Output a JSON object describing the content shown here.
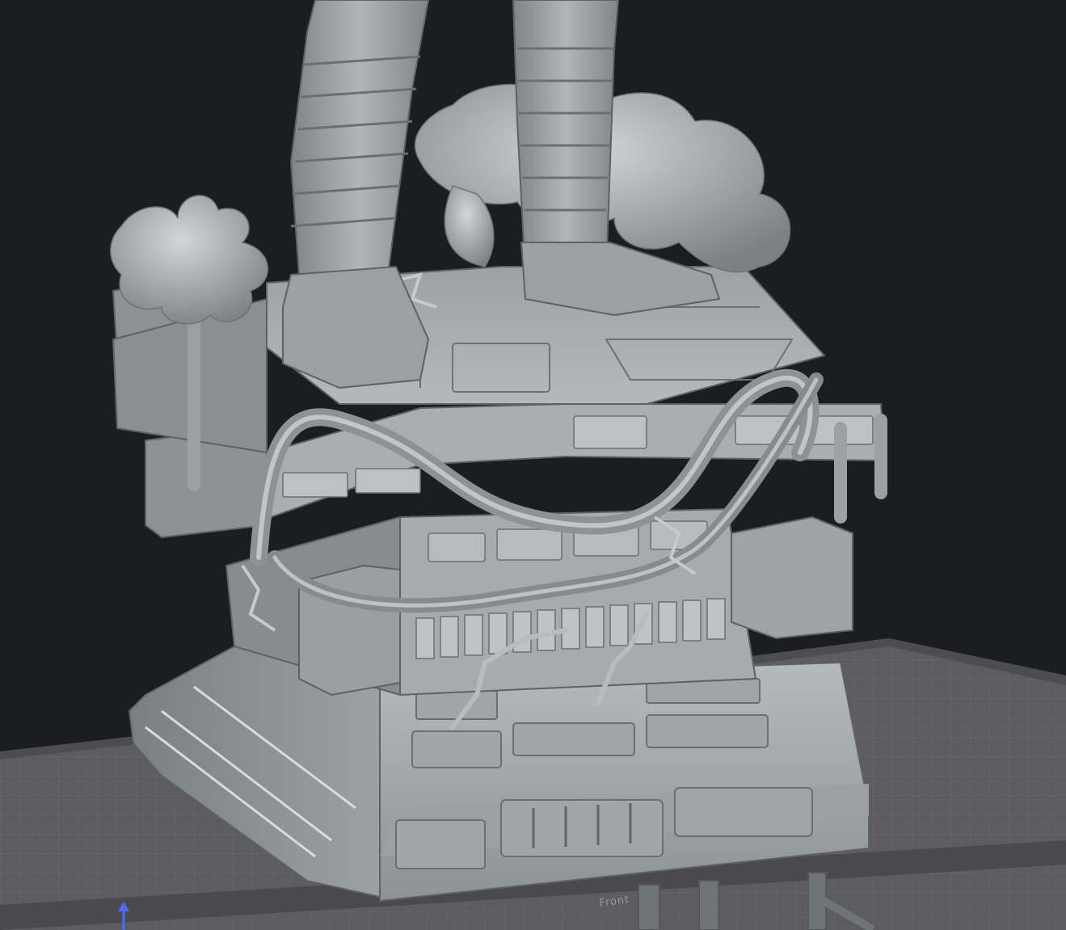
{
  "viewport": {
    "background_color": "#1c1d20",
    "model_color": "#a9aeb1",
    "plate_color": "#5d5d5f",
    "plate_grid_color": "#707073",
    "plate_label": "Front"
  },
  "axis_gizmo": {
    "icon": "up-arrow-icon",
    "color": "#4a6cff"
  }
}
